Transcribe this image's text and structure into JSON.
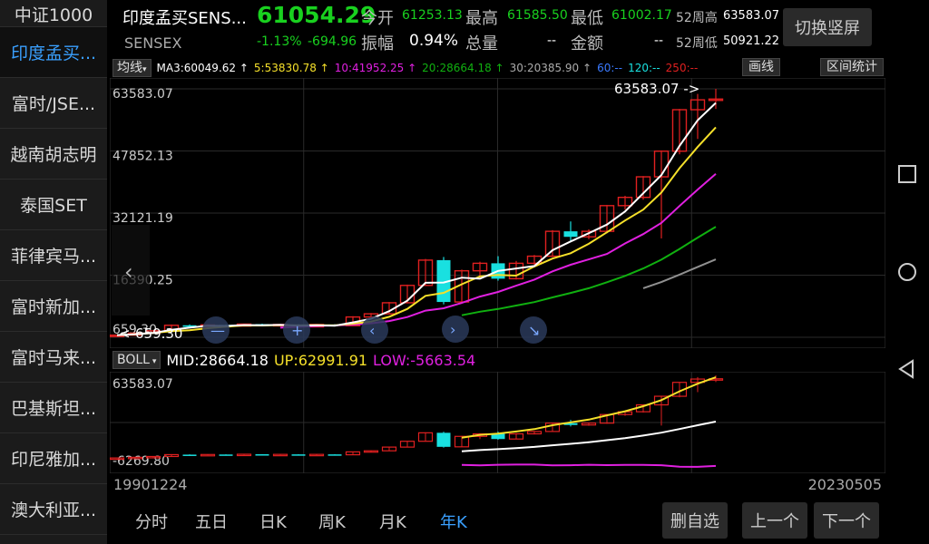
{
  "sidebar": {
    "items": [
      {
        "label": "中证1000",
        "active": false
      },
      {
        "label": "印度孟买...",
        "active": true
      },
      {
        "label": "富时/JSE...",
        "active": false
      },
      {
        "label": "越南胡志明",
        "active": false
      },
      {
        "label": "泰国SET",
        "active": false
      },
      {
        "label": "菲律宾马...",
        "active": false
      },
      {
        "label": "富时新加...",
        "active": false
      },
      {
        "label": "富时马来...",
        "active": false
      },
      {
        "label": "巴基斯坦...",
        "active": false
      },
      {
        "label": "印尼雅加...",
        "active": false
      },
      {
        "label": "澳大利亚...",
        "active": false
      }
    ]
  },
  "header": {
    "name": "印度孟买SENS...",
    "code": "SENSEX",
    "price": "61054.29",
    "change_pct": "-1.13%",
    "change": "-694.96",
    "open_label": "今开",
    "open": "61253.13",
    "high_label": "最高",
    "high": "61585.50",
    "low_label": "最低",
    "low": "61002.17",
    "wk52_high_label": "52周高",
    "wk52_high": "63583.07",
    "amplitude_label": "振幅",
    "amplitude": "0.94%",
    "volume_label": "总量",
    "volume": "--",
    "amount_label": "金额",
    "amount": "--",
    "wk52_low_label": "52周低",
    "wk52_low": "50921.22",
    "switch_label": "切换竖屏"
  },
  "ma_bar": {
    "tag": "均线",
    "ma3": "MA3:60049.62 ↑",
    "ma5": "5:53830.78 ↑",
    "ma10": "10:41952.25 ↑",
    "ma20": "20:28664.18 ↑",
    "ma30": "30:20385.90 ↑",
    "ma60": "60:--",
    "ma120": "120:--",
    "ma250": "250:--",
    "draw_label": "画线",
    "range_label": "区间统计"
  },
  "colors": {
    "up": "#e02020",
    "down": "#19e0e0",
    "ma3": "#ffffff",
    "ma5": "#f5e02a",
    "ma10": "#e020e0",
    "ma20": "#10b010",
    "ma30": "#909090",
    "ma60": "#3a7aff",
    "ma120": "#19e0e0",
    "ma250": "#e02020",
    "accent": "#3aa0ff"
  },
  "kchart": {
    "y_labels": [
      "63583.07",
      "47852.13",
      "32121.19",
      "16390.25",
      "659.30"
    ],
    "max_marker": "63583.07 ->",
    "min_marker": "<-659.30"
  },
  "boll": {
    "tag": "BOLL",
    "mid": "MID:28664.18",
    "up": "UP:62991.91",
    "low": "LOW:-5663.54",
    "y_top": "63583.07",
    "y_bottom": "-6269.80"
  },
  "dates": {
    "start": "19901224",
    "end": "20230505"
  },
  "periods": [
    {
      "label": "分时",
      "active": false
    },
    {
      "label": "五日",
      "active": false
    },
    {
      "label": "日K",
      "active": false
    },
    {
      "label": "周K",
      "active": false
    },
    {
      "label": "月K",
      "active": false
    },
    {
      "label": "年K",
      "active": true
    }
  ],
  "buttons": {
    "remove": "删自选",
    "prev": "上一个",
    "next": "下一个"
  },
  "chart_data": {
    "type": "candlestick",
    "ylim": [
      659.3,
      63583.07
    ],
    "candles": [
      {
        "o": 1000,
        "c": 1200,
        "h": 1300,
        "l": 900
      },
      {
        "o": 1200,
        "c": 1700,
        "h": 1800,
        "l": 1100
      },
      {
        "o": 1700,
        "c": 2300,
        "h": 2400,
        "l": 1600
      },
      {
        "o": 2300,
        "c": 3700,
        "h": 3900,
        "l": 2200
      },
      {
        "o": 3700,
        "c": 3300,
        "h": 3900,
        "l": 3100
      },
      {
        "o": 3300,
        "c": 3800,
        "h": 4000,
        "l": 3200
      },
      {
        "o": 3800,
        "c": 3500,
        "h": 3900,
        "l": 3300
      },
      {
        "o": 3500,
        "c": 4000,
        "h": 4100,
        "l": 3400
      },
      {
        "o": 4000,
        "c": 3600,
        "h": 4100,
        "l": 3500
      },
      {
        "o": 3600,
        "c": 3900,
        "h": 4000,
        "l": 3400
      },
      {
        "o": 3900,
        "c": 3300,
        "h": 4000,
        "l": 3200
      },
      {
        "o": 3300,
        "c": 3900,
        "h": 4000,
        "l": 3200
      },
      {
        "o": 3900,
        "c": 3600,
        "h": 4000,
        "l": 3500
      },
      {
        "o": 3600,
        "c": 5800,
        "h": 6000,
        "l": 3500
      },
      {
        "o": 5800,
        "c": 6600,
        "h": 6800,
        "l": 5700
      },
      {
        "o": 6600,
        "c": 9400,
        "h": 9600,
        "l": 6500
      },
      {
        "o": 9400,
        "c": 13800,
        "h": 14000,
        "l": 9300
      },
      {
        "o": 13800,
        "c": 20200,
        "h": 20500,
        "l": 13700
      },
      {
        "o": 20200,
        "c": 9600,
        "h": 21000,
        "l": 9000
      },
      {
        "o": 9600,
        "c": 17500,
        "h": 17800,
        "l": 9400
      },
      {
        "o": 17500,
        "c": 19400,
        "h": 19800,
        "l": 15500
      },
      {
        "o": 19400,
        "c": 15500,
        "h": 21200,
        "l": 15000
      },
      {
        "o": 15500,
        "c": 19400,
        "h": 20000,
        "l": 15300
      },
      {
        "o": 19400,
        "c": 21200,
        "h": 21500,
        "l": 19000
      },
      {
        "o": 21200,
        "c": 27500,
        "h": 27800,
        "l": 21000
      },
      {
        "o": 27500,
        "c": 26100,
        "h": 30000,
        "l": 25000
      },
      {
        "o": 26100,
        "c": 27500,
        "h": 28000,
        "l": 25500
      },
      {
        "o": 27500,
        "c": 34000,
        "h": 34200,
        "l": 27000
      },
      {
        "o": 34000,
        "c": 36100,
        "h": 36500,
        "l": 33000
      },
      {
        "o": 36100,
        "c": 41300,
        "h": 41500,
        "l": 35500
      },
      {
        "o": 41300,
        "c": 47800,
        "h": 48000,
        "l": 25700
      },
      {
        "o": 47800,
        "c": 58300,
        "h": 58500,
        "l": 47000
      },
      {
        "o": 58300,
        "c": 60800,
        "h": 62300,
        "l": 50900
      },
      {
        "o": 60800,
        "c": 61000,
        "h": 63583,
        "l": 58500
      }
    ]
  }
}
